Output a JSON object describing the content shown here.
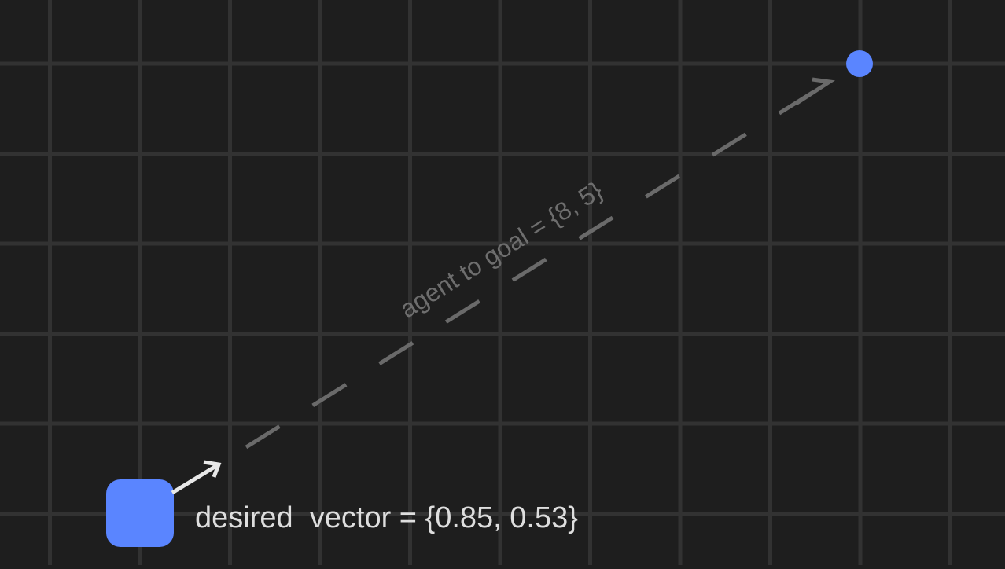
{
  "colors": {
    "background": "#1e1e1e",
    "grid": "#323232",
    "agent": "#5a85ff",
    "goal": "#5a85ff",
    "dashed_line": "#6a6a6a",
    "desired_arrow": "#e8e8e8",
    "path_label": "#6e6e6e",
    "desired_label": "#dedede"
  },
  "labels": {
    "path": "agent to goal = {8, 5}",
    "desired": "desired  vector = {0.85, 0.53}"
  },
  "vectors": {
    "agent_to_goal": [
      8,
      5
    ],
    "desired": [
      0.85,
      0.53
    ]
  }
}
